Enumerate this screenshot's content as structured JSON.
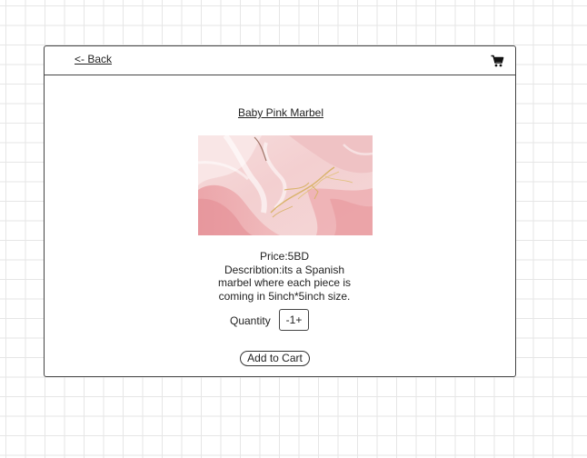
{
  "header": {
    "back_label": "<- Back",
    "cart_icon": "cart-icon"
  },
  "product": {
    "title": "Baby Pink Marbel",
    "image_icon": "marble-image",
    "price": "Price:5BD",
    "description_lines": [
      "Describtion:its a Spanish",
      "marbel where each piece is",
      "coming in 5inch*5inch size."
    ],
    "quantity_label": "Quantity",
    "quantity_value": "-1+",
    "add_to_cart_label": "Add to Cart"
  },
  "colors": {
    "marble_base": "#f1c9c9",
    "marble_vein": "#d9b36a"
  }
}
